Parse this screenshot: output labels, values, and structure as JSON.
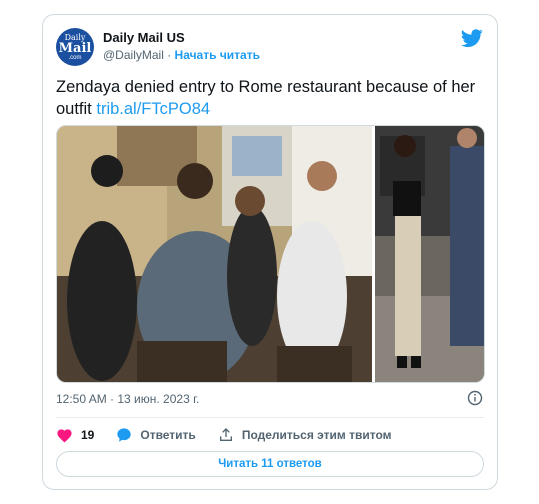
{
  "account": {
    "name": "Daily Mail US",
    "handle": "@DailyMail",
    "separator": "·",
    "follow_label": "Начать читать",
    "avatar_line1": "Daily",
    "avatar_line2": "Mail",
    "avatar_line3": ".com"
  },
  "tweet": {
    "text": "Zendaya denied entry to Rome restaurant because of her outfit",
    "link": "trib.al/FTcPO84",
    "timestamp": "12:50 AM · 13 июн. 2023 г."
  },
  "actions": {
    "like_count": "19",
    "reply_label": "Ответить",
    "share_label": "Поделиться этим твитом"
  },
  "replies_button": "Читать 11 ответов",
  "colors": {
    "accent": "#1d9bf0",
    "like": "#f91880",
    "avatar_bg": "#1b4fa0"
  },
  "icons": [
    "twitter-bird-icon",
    "info-icon",
    "heart-icon",
    "reply-bubble-icon",
    "share-icon"
  ]
}
